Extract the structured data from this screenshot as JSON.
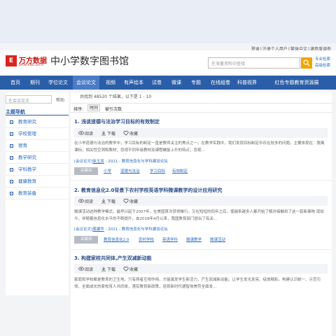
{
  "toplinks": [
    "登录",
    "注册个人用户",
    "繁体中文",
    "满意度调查"
  ],
  "logo": {
    "mark": "E",
    "cn": "万方数据",
    "en": "WANFANG DATA"
  },
  "site_title": "中小学数字图书馆",
  "search": {
    "placeholder": "在海量资料中查找"
  },
  "adv_links": [
    "专业检索",
    "高级检索"
  ],
  "nav": [
    "首页",
    "期刊",
    "学位论文",
    "会议论文",
    "视频",
    "有声绘本",
    "试卷",
    "微课",
    "专题",
    "在线组卷",
    "科普视界",
    "红色专题教育资源展"
  ],
  "nav_active": "会议论文",
  "sidebar": {
    "search_placeholder": "在会议论文",
    "help": "帮助",
    "title": "主题导航",
    "items": [
      "教育研究",
      "学校管理",
      "德育",
      "教学研究",
      "学科教学",
      "健康教育",
      "教育装备"
    ]
  },
  "result_count": "共找到 48520 个结果，以下是 1 - 10",
  "sort": {
    "label": "排序:",
    "time": "时间",
    "cite": "被引次数"
  },
  "actions": {
    "read": "阅读",
    "download": "下载",
    "favorite": "收藏"
  },
  "keyword_label": "关键词",
  "results": [
    {
      "title": "1. 浅谈道德与法治学习目标的有效制定",
      "abstract": "在小学道德与法治的教学中，学习目标的制定一直是教师关注的焦点之一。在教学实践中，我们发现目标制定中存在较多的问题。主要体现在：脱离课标，相关性空洞和教材；忽视不同年级教材及课程螺旋上升的特点；忽视...",
      "source_prefix": "[会议论文]",
      "author": "徐玉双",
      "source_rest": "- 2021 - 教育信息化与学科建设论坛",
      "keywords": [
        "小学",
        "道德与法治",
        "学习目标",
        "有效制定"
      ]
    },
    {
      "title": "2. 教育信息化2.0背景下农村学校英语学科微课教学的设计应用研究",
      "abstract": "微课活动这种教学模式，最早兴起于2007年，在美国首次获得推行，又在短短的四年之后，使越来越多人都开始了解并接触到了这一崭新事物 现如今，伴随着信息化水平的不断提升，自2018年4月以来，我国教育部门提出了有关...",
      "source_prefix": "[会议论文]",
      "author": "周建华",
      "source_rest": "- 2021 - 教育信息化与学科建设论坛",
      "keywords": [
        "教育信息化2.0",
        "农村学校",
        "英语学科",
        "微课教学",
        "微课活动"
      ]
    },
    {
      "title": "3. 构建家校共同体,产生双减新动能",
      "abstract": "家庭和学校都是教育的卫生地。只有两者互相作用，才能激发学生新活力，产生双减新动能。让学生发光发亮、绽放精彩。构建认识统一、示范引领、全面成长的家校育人共同体，落实教育新政策，培育新时代德智体美劳全面发..."
    }
  ]
}
